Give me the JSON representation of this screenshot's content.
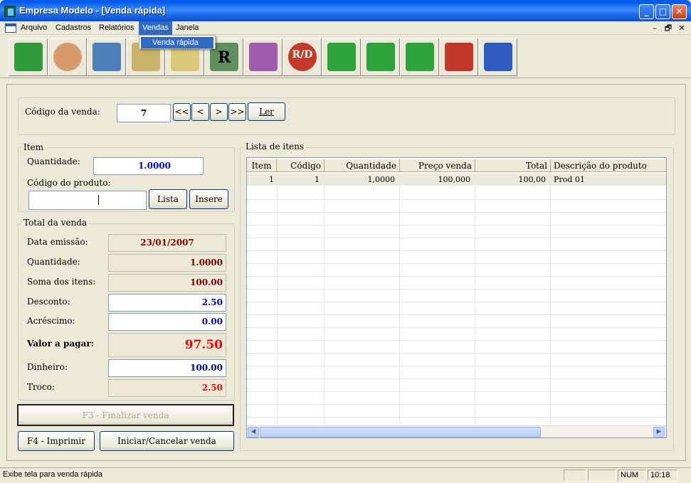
{
  "window": {
    "title": "Empresa Modelo - [Venda rápida]",
    "caption_buttons": {
      "minimize": "_",
      "maximize": "□",
      "close": "✕"
    }
  },
  "menubar": {
    "items": [
      "Arquivo",
      "Cadastros",
      "Relatórios",
      "Vendas",
      "Janela"
    ],
    "active": "Vendas",
    "mdi_controls": {
      "minimize": "–",
      "restore": "🗗",
      "close": "✕"
    }
  },
  "dropdown": {
    "items": [
      "Venda rápida"
    ]
  },
  "toolbar": {
    "buttons": [
      {
        "name": "map-icon",
        "color": "#2f9a3a"
      },
      {
        "name": "users-icon",
        "color": "#d89a6a"
      },
      {
        "name": "file-cabinet-icon",
        "color": "#4f7fb8"
      },
      {
        "name": "documents-icon",
        "color": "#c9b36a"
      },
      {
        "name": "notepad-icon",
        "color": "#d8c878"
      },
      {
        "name": "report-icon",
        "color": "#5f8f5f",
        "glyph": "R"
      },
      {
        "name": "calculator-icon",
        "color": "#a05ab0"
      },
      {
        "name": "rd-icon",
        "color": "#c23a2a",
        "glyph": "R/D"
      },
      {
        "name": "refresh-icon",
        "color": "#2da33b"
      },
      {
        "name": "home-icon",
        "color": "#2da33b"
      },
      {
        "name": "pen-icon",
        "color": "#2da33b"
      },
      {
        "name": "chart-icon",
        "color": "#c0392b"
      },
      {
        "name": "chart-blue-icon",
        "color": "#2e5bc0"
      }
    ]
  },
  "sale_header": {
    "code_label": "Código da venda:",
    "code_value": "7",
    "nav_first": "<<",
    "nav_prev": "<",
    "nav_next": ">",
    "nav_last": ">>",
    "read_button": "Ler"
  },
  "item_group": {
    "title": "Item",
    "quantity_label": "Quantidade:",
    "quantity_value": "1.0000",
    "product_code_label": "Código do produto:",
    "product_code_value": "",
    "list_button": "Lista",
    "insert_button": "Insere"
  },
  "total_group": {
    "title": "Total da venda",
    "rows": [
      {
        "label": "Data emissão:",
        "value": "23/01/2007"
      },
      {
        "label": "Quantidade:",
        "value": "1.0000"
      },
      {
        "label": "Soma dos itens:",
        "value": "100.00"
      },
      {
        "label": "Desconto:",
        "value": "2.50"
      },
      {
        "label": "Acréscimo:",
        "value": "0.00"
      },
      {
        "label": "Valor a pagar:",
        "value": "97.50"
      },
      {
        "label": "Dinheiro:",
        "value": "100.00"
      },
      {
        "label": "Troco:",
        "value": "2.50"
      }
    ],
    "colors": {
      "readonly": "#800000",
      "editable": "#0000a0",
      "highlight": "#ff0000"
    }
  },
  "actions": {
    "finalize": "F3 - Finalizar venda",
    "print": "F4 - Imprimir",
    "start_cancel": "Iniciar/Cancelar venda"
  },
  "items_list": {
    "title": "Lista de itens",
    "columns": [
      "Item",
      "Código",
      "Quantidade",
      "Preço venda",
      "Total",
      "Descrição do produto"
    ],
    "rows": [
      [
        "1",
        "1",
        "1,0000",
        "100,000",
        "100,00",
        "Prod 01"
      ]
    ]
  },
  "statusbar": {
    "message": "Exibe tela para venda rápida",
    "num": "NUM",
    "time": "10:18"
  }
}
